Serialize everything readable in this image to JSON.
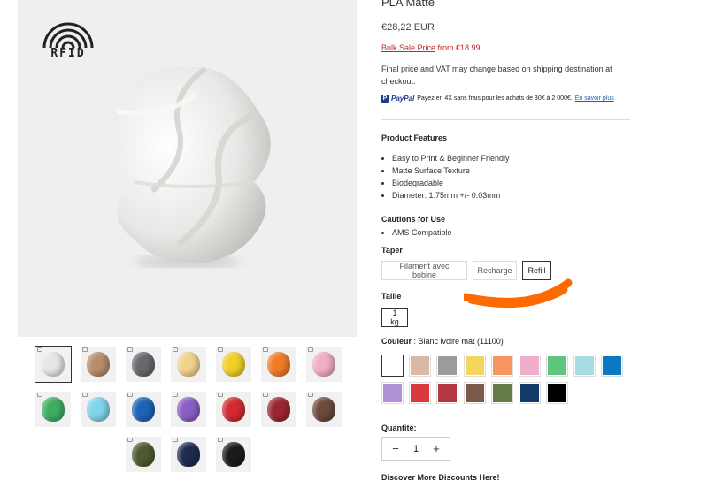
{
  "product": {
    "title": "PLA Matte",
    "price": "€28,22 EUR",
    "bulk_link": "Bulk Sale Price",
    "bulk_rest": " from €18.99.",
    "vat_note": "Final price and VAT may change based on shipping destination at checkout.",
    "paypal": {
      "brand": "PayPal",
      "text": "Payez en 4X sans frais pour les achats de 30€ à 2 000€.",
      "link": "En savoir plus"
    }
  },
  "gallery": {
    "badge_text": "RFID",
    "thumbnail_colors": [
      "#e6e6e4",
      "#b78d6b",
      "#66686c",
      "#f2d38c",
      "#f0cf29",
      "#ef7c26",
      "#eeaec3",
      "#3dae62",
      "#7fd3ea",
      "#1e63b7",
      "#8a5fc4",
      "#d32a31",
      "#9c2630",
      "#6b4a3a",
      "#4d5a2f",
      "#1d2b4f",
      "#1b1b1d"
    ]
  },
  "features": {
    "heading": "Product Features",
    "items": [
      "Easy to Print & Beginner Friendly",
      "Matte Surface Texture",
      "Biodegradable",
      "Diameter: 1.75mm +/- 0.03mm"
    ]
  },
  "cautions": {
    "heading": "Cautions for Use",
    "items": [
      "AMS Compatible"
    ]
  },
  "taper": {
    "label": "Taper",
    "options": [
      "Filament avec bobine",
      "Recharge",
      "Refill"
    ],
    "selected": "Refill"
  },
  "taille": {
    "label": "Taille",
    "options": [
      "1 kg"
    ],
    "selected": "1 kg"
  },
  "couleur": {
    "label": "Couleur",
    "value": " : Blanc ivoire mat (11100)",
    "swatches": [
      "#ffffff",
      "#d9b9a5",
      "#9b9b9b",
      "#f5d65c",
      "#f6955f",
      "#efaecb",
      "#5ec47e",
      "#a5dbe3",
      "#0a78c2",
      "#b191d6",
      "#d8393c",
      "#b43640",
      "#7a5a48",
      "#647a47",
      "#123a66",
      "#000000"
    ]
  },
  "quantity": {
    "label": "Quantité:",
    "value": "1",
    "minus": "−",
    "plus": "+"
  },
  "discounts": "Discover More Discounts Here!",
  "colors": {
    "annotation": "#ff6a00",
    "bulk_red": "#c1272d"
  }
}
